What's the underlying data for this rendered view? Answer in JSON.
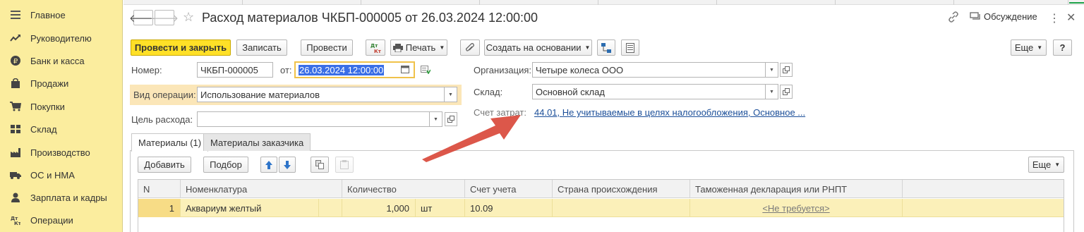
{
  "sidebar": {
    "items": [
      {
        "label": "Главное",
        "icon": "menu-lines-icon"
      },
      {
        "label": "Руководителю",
        "icon": "trend-chart-icon"
      },
      {
        "label": "Банк и касса",
        "icon": "ruble-coin-icon"
      },
      {
        "label": "Продажи",
        "icon": "shopping-bag-icon"
      },
      {
        "label": "Покупки",
        "icon": "cart-icon"
      },
      {
        "label": "Склад",
        "icon": "warehouse-grid-icon"
      },
      {
        "label": "Производство",
        "icon": "factory-icon"
      },
      {
        "label": "ОС и НМА",
        "icon": "truck-icon"
      },
      {
        "label": "Зарплата и кадры",
        "icon": "person-icon"
      },
      {
        "label": "Операции",
        "icon": "dt-kt-icon"
      }
    ]
  },
  "header": {
    "title": "Расход материалов ЧКБП-000005 от 26.03.2024 12:00:00",
    "discussion_label": "Обсуждение"
  },
  "toolbar": {
    "post_close_label": "Провести и закрыть",
    "save_label": "Записать",
    "post_label": "Провести",
    "dtkt_label": "Дт Кт",
    "print_label": "Печать",
    "create_based_label": "Создать на основании",
    "more_label": "Еще",
    "help_label": "?"
  },
  "form": {
    "number_label": "Номер:",
    "number_value": "ЧКБП-000005",
    "date_label": "от:",
    "date_value": "26.03.2024 12:00:00",
    "operation_label": "Вид операции:",
    "operation_value": "Использование материалов",
    "purpose_label": "Цель расхода:",
    "purpose_value": "",
    "org_label": "Организация:",
    "org_value": "Четыре колеса ООО",
    "warehouse_label": "Склад:",
    "warehouse_value": "Основной склад",
    "cost_account_label": "Счет затрат:",
    "cost_account_value": "44.01, Не учитываемые в целях налогообложения, Основное ..."
  },
  "tabs": [
    {
      "label": "Материалы (1)",
      "active": true
    },
    {
      "label": "Материалы заказчика",
      "active": false
    }
  ],
  "table_toolbar": {
    "add_label": "Добавить",
    "select_label": "Подбор",
    "more_label": "Еще"
  },
  "table": {
    "columns": [
      "N",
      "Номенклатура",
      "Количество",
      "Счет учета",
      "Страна происхождения",
      "Таможенная декларация или РНПТ"
    ],
    "rows": [
      {
        "n": "1",
        "item": "Аквариум желтый",
        "qty": "1,000",
        "unit": "шт",
        "account": "10.09",
        "country": "",
        "customs": "<Не требуется>"
      }
    ]
  },
  "colors": {
    "sidebar_bg": "#fbed9e",
    "primary_button": "#ffe027",
    "link": "#1c4f99",
    "row_highlight": "#fbf0b9",
    "annotation_arrow": "#d9493b"
  }
}
